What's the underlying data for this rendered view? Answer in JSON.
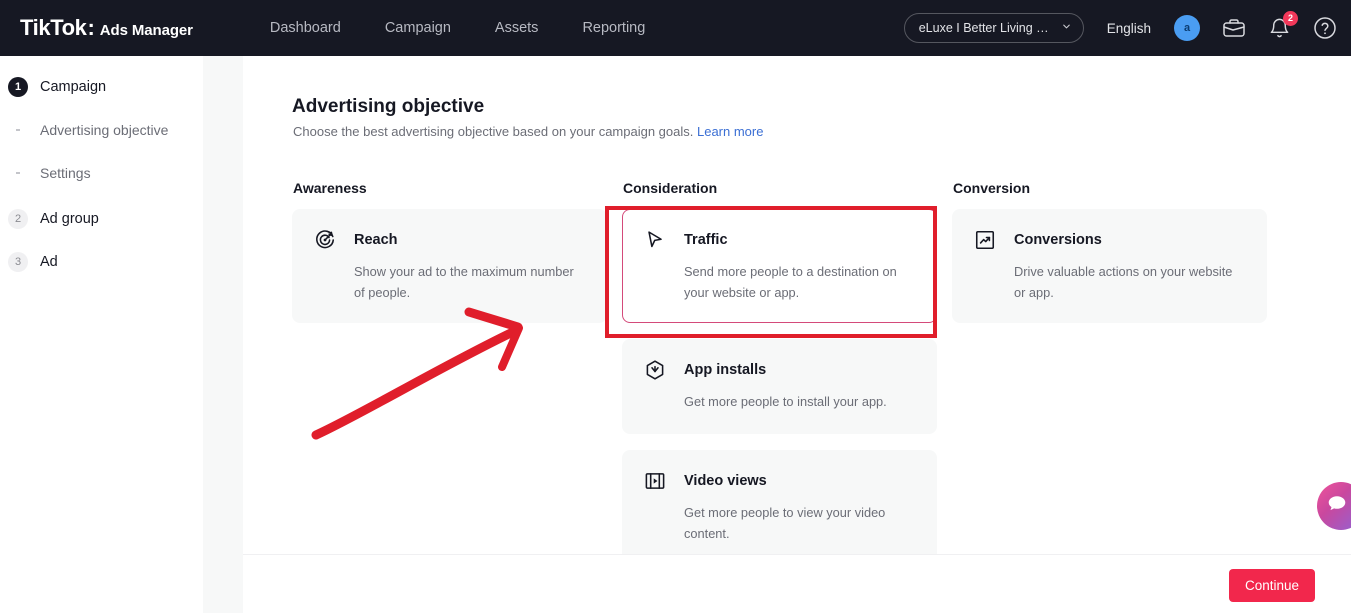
{
  "header": {
    "logo_primary": "TikTok",
    "logo_colon": ":",
    "logo_secondary": "Ads Manager",
    "nav": [
      {
        "label": "Dashboard",
        "name": "nav-dashboard"
      },
      {
        "label": "Campaign",
        "name": "nav-campaign"
      },
      {
        "label": "Assets",
        "name": "nav-assets"
      },
      {
        "label": "Reporting",
        "name": "nav-reporting"
      }
    ],
    "account_selector": "eLuxe I Better Living Sh...",
    "language": "English",
    "avatar_initial": "a",
    "notification_count": "2",
    "icons": {
      "chevron": "chevron-down-icon",
      "briefcase": "briefcase-icon",
      "bell": "bell-icon",
      "help": "help-circle-icon"
    }
  },
  "sidebar": {
    "steps": [
      {
        "num": "1",
        "label": "Campaign",
        "active": true
      },
      {
        "num": "2",
        "label": "Ad group",
        "active": false
      },
      {
        "num": "3",
        "label": "Ad",
        "active": false
      }
    ],
    "sub_items": [
      {
        "label": "Advertising objective"
      },
      {
        "label": "Settings"
      }
    ]
  },
  "main": {
    "title": "Advertising objective",
    "description": "Choose the best advertising objective based on your campaign goals.",
    "learn_more": "Learn more",
    "columns": [
      {
        "heading": "Awareness",
        "cards": [
          {
            "title": "Reach",
            "description": "Show your ad to the maximum number of people.",
            "icon": "target-arrow-icon",
            "selected": false
          }
        ]
      },
      {
        "heading": "Consideration",
        "cards": [
          {
            "title": "Traffic",
            "description": "Send more people to a destination on your website or app.",
            "icon": "cursor-pointer-icon",
            "selected": true
          },
          {
            "title": "App installs",
            "description": "Get more people to install your app.",
            "icon": "hexagon-download-icon",
            "selected": false
          },
          {
            "title": "Video views",
            "description": "Get more people to view your video content.",
            "icon": "film-play-icon",
            "selected": false
          }
        ]
      },
      {
        "heading": "Conversion",
        "cards": [
          {
            "title": "Conversions",
            "description": "Drive valuable actions on your website or app.",
            "icon": "trend-up-box-icon",
            "selected": false
          }
        ]
      }
    ]
  },
  "footer": {
    "continue_label": "Continue"
  },
  "widgets": {
    "chat_icon": "chat-bubble-icon"
  },
  "annotations": {
    "highlight_box_color": "#e01e2b",
    "arrow_color": "#e01e2b",
    "selected_card_border": "#d44a7a",
    "accent": "#f2274c"
  }
}
